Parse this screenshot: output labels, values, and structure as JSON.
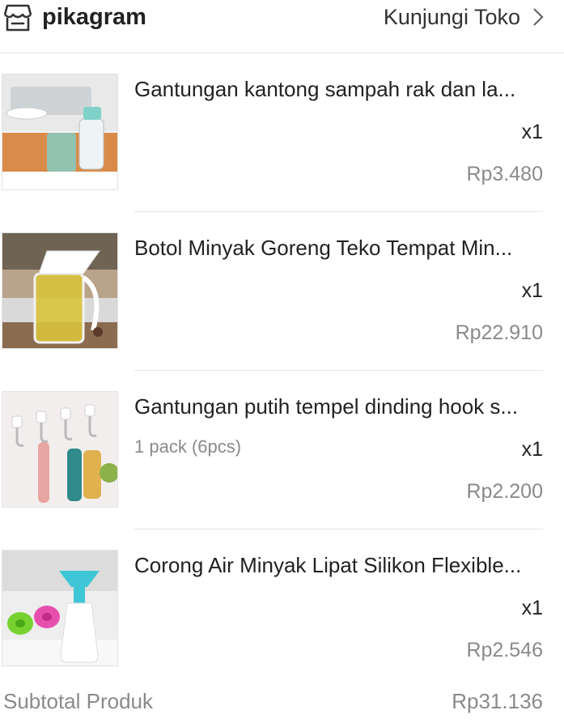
{
  "shop": {
    "name": "pikagram",
    "visit_label": "Kunjungi Toko",
    "icon": "store-icon",
    "chevron_icon": "chevron-right-icon"
  },
  "items": [
    {
      "title": "Gantungan kantong sampah rak dan la...",
      "variant": "",
      "qty": "x1",
      "price": "Rp3.480"
    },
    {
      "title": "Botol Minyak Goreng Teko Tempat Min...",
      "variant": "",
      "qty": "x1",
      "price": "Rp22.910"
    },
    {
      "title": "Gantungan putih tempel dinding hook s...",
      "variant": "1 pack (6pcs)",
      "qty": "x1",
      "price": "Rp2.200"
    },
    {
      "title": "Corong Air Minyak Lipat Silikon Flexible...",
      "variant": "",
      "qty": "x1",
      "price": "Rp2.546"
    }
  ],
  "subtotal": {
    "label": "Subtotal Produk",
    "value": "Rp31.136"
  },
  "colors": {
    "text": "#222222",
    "muted": "#8a8a8a",
    "divider": "#e6e6e6"
  }
}
